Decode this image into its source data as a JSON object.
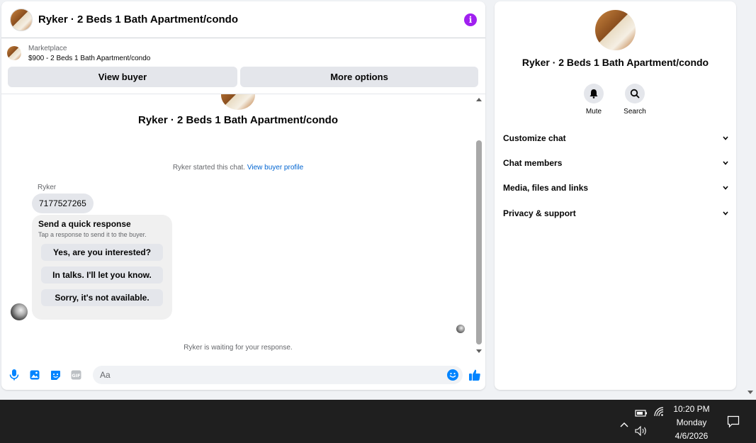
{
  "chat": {
    "title": "Ryker · 2 Beds 1 Bath Apartment/condo",
    "marketplace_label": "Marketplace",
    "listing_price_title": "$900 - 2 Beds 1 Bath Apartment/condo",
    "view_buyer_label": "View buyer",
    "more_options_label": "More options",
    "conversation_title": "Ryker · 2 Beds 1 Bath Apartment/condo",
    "started_text": "Ryker started this chat.",
    "view_buyer_profile_link": "View buyer profile",
    "sender_name": "Ryker",
    "phone_message": "7177527265",
    "quick_response": {
      "title": "Send a quick response",
      "subtitle": "Tap a response to send it to the buyer.",
      "options": [
        "Yes, are you interested?",
        "In talks. I'll let you know.",
        "Sorry, it's not available."
      ]
    },
    "waiting_text": "Ryker is waiting for your response.",
    "input_placeholder": "Aa"
  },
  "info": {
    "title": "Ryker · 2 Beds 1 Bath Apartment/condo",
    "mute_label": "Mute",
    "search_label": "Search",
    "sections": [
      "Customize chat",
      "Chat members",
      "Media, files and links",
      "Privacy & support"
    ]
  },
  "taskbar": {
    "time": "10:20 PM",
    "day": "Monday",
    "date": "4/6/2026"
  },
  "colors": {
    "accent": "#0084ff",
    "info_purple": "#a020f0",
    "link": "#0064d1",
    "taskbar": "#1f1f1f"
  }
}
